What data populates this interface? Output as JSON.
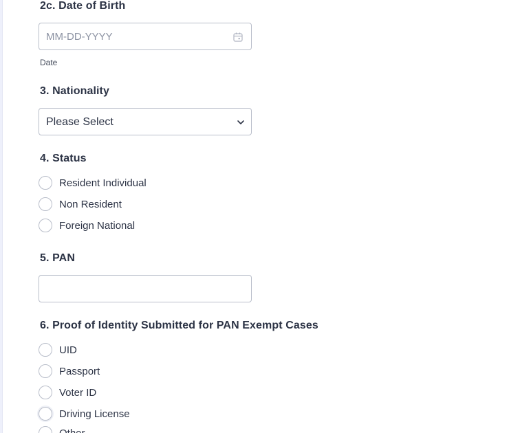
{
  "dob": {
    "label": "2c. Date of Birth",
    "placeholder": "MM-DD-YYYY",
    "sublabel": "Date",
    "icon": "calendar-icon"
  },
  "nationality": {
    "label": "3. Nationality",
    "selected": "Please Select",
    "icon": "chevron-down-icon"
  },
  "status": {
    "label": "4. Status",
    "options": [
      {
        "label": "Resident Individual"
      },
      {
        "label": "Non Resident"
      },
      {
        "label": "Foreign National"
      }
    ]
  },
  "pan": {
    "label": "5. PAN",
    "value": ""
  },
  "proof": {
    "label": "6. Proof of Identity Submitted for PAN Exempt Cases",
    "options": [
      {
        "label": "UID"
      },
      {
        "label": "Passport"
      },
      {
        "label": "Voter ID"
      },
      {
        "label": "Driving License"
      },
      {
        "label": "Other"
      }
    ]
  },
  "colors": {
    "text": "#2c3345",
    "border": "#b8bdc9",
    "placeholder": "#8d93a3"
  }
}
